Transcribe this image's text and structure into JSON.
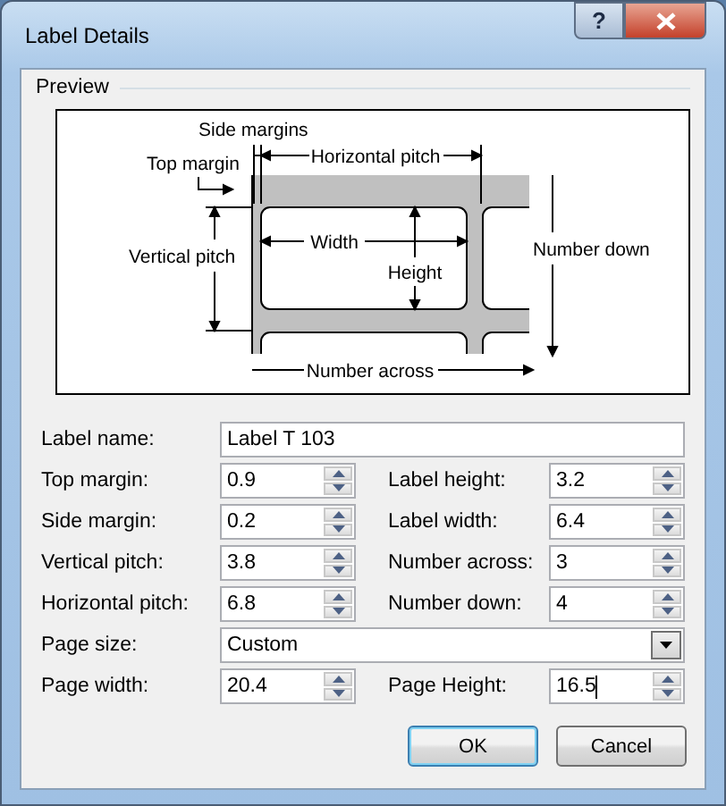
{
  "window": {
    "title": "Label Details",
    "help": "?"
  },
  "preview": {
    "title": "Preview",
    "diagram_labels": [
      "Side margins",
      "Top margin",
      "Horizontal pitch",
      "Vertical pitch",
      "Width",
      "Height",
      "Number down",
      "Number across"
    ]
  },
  "label_name": {
    "label": "Label name:",
    "value": "Label T 103"
  },
  "rows": [
    [
      {
        "label": "Top margin:",
        "value": "0.9"
      },
      {
        "label": "Label height:",
        "value": "3.2"
      }
    ],
    [
      {
        "label": "Side margin:",
        "value": "0.2"
      },
      {
        "label": "Label width:",
        "value": "6.4"
      }
    ],
    [
      {
        "label": "Vertical pitch:",
        "value": "3.8"
      },
      {
        "label": "Number across:",
        "value": "3"
      }
    ],
    [
      {
        "label": "Horizontal pitch:",
        "value": "6.8"
      },
      {
        "label": "Number down:",
        "value": "4"
      }
    ]
  ],
  "page_size": {
    "label": "Page size:",
    "value": "Custom"
  },
  "page_dims": [
    {
      "label": "Page width:",
      "value": "20.4"
    },
    {
      "label": "Page Height:",
      "value": "16.5"
    }
  ],
  "buttons": [
    {
      "label": "OK",
      "default": true
    },
    {
      "label": "Cancel",
      "default": false
    }
  ]
}
